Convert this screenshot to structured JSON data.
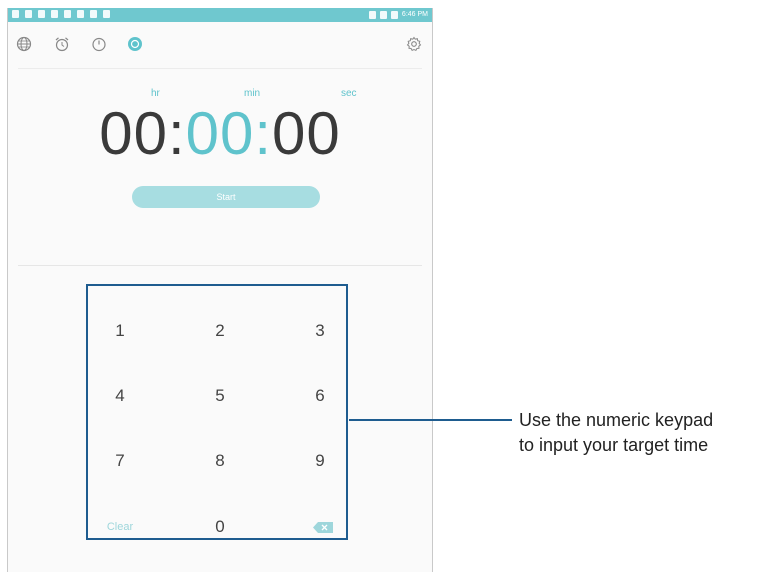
{
  "status_bar": {
    "time": "6:46 PM"
  },
  "toolbar": {
    "tabs": [
      "world-clock",
      "alarm",
      "stopwatch",
      "timer"
    ],
    "active_tab": "timer",
    "settings": "settings"
  },
  "timer": {
    "units": {
      "hr": "hr",
      "min": "min",
      "sec": "sec"
    },
    "hours": "00",
    "minutes": "00",
    "seconds": "00",
    "sep1": ":",
    "sep2": ":",
    "start_label": "Start"
  },
  "keypad": {
    "keys": [
      "1",
      "2",
      "3",
      "4",
      "5",
      "6",
      "7",
      "8",
      "9"
    ],
    "clear_label": "Clear",
    "zero": "0"
  },
  "callout": {
    "line1": "Use the numeric keypad",
    "line2": "to input your target time"
  },
  "colors": {
    "accent": "#5fc3cc",
    "status_bar": "#6fc8cf",
    "callout_border": "#1e5c8f"
  }
}
